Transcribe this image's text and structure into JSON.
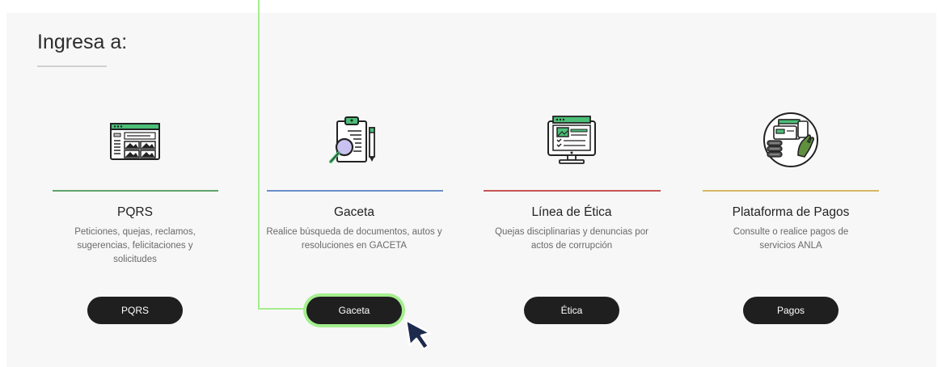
{
  "section": {
    "heading": "Ingresa a:"
  },
  "cards": [
    {
      "title": "PQRS",
      "description": "Peticiones, quejas, reclamos, sugerencias, felicitaciones y solicitudes",
      "button_label": "PQRS",
      "accent_color": "#5fa36b",
      "icon": "gallery-window-icon"
    },
    {
      "title": "Gaceta",
      "description": "Realice búsqueda de documentos, autos y resoluciones en GACETA",
      "button_label": "Gaceta",
      "accent_color": "#6a8fc9",
      "icon": "clipboard-search-icon"
    },
    {
      "title": "Línea de Ética",
      "description": "Quejas disciplinarias y denuncias por actos de corrupción",
      "button_label": "Ética",
      "accent_color": "#c65555",
      "icon": "monitor-checklist-icon"
    },
    {
      "title": "Plataforma de Pagos",
      "description": "Consulte o realice pagos de servicios ANLA",
      "button_label": "Pagos",
      "accent_color": "#d7b765",
      "icon": "payment-hand-icon"
    }
  ],
  "colors": {
    "highlight": "#a4ee8e",
    "button_bg": "#1f1f1f",
    "panel_bg": "#f7f7f7",
    "cursor": "#1d2a4d"
  }
}
